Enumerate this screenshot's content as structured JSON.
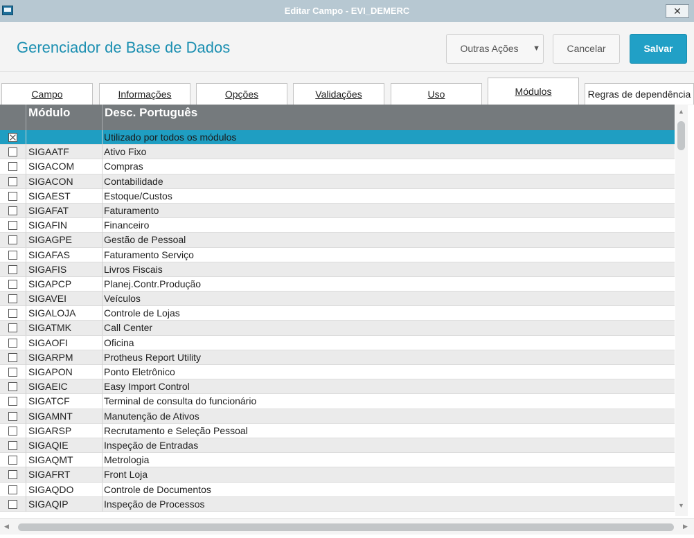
{
  "window": {
    "title": "Editar Campo - EVI_DEMERC",
    "close_glyph": "✕"
  },
  "header": {
    "title": "Gerenciador de Base de Dados",
    "other_actions_label": "Outras Ações",
    "cancel_label": "Cancelar",
    "save_label": "Salvar"
  },
  "tabs": [
    {
      "label": "Campo"
    },
    {
      "label": "Informações"
    },
    {
      "label": "Opções"
    },
    {
      "label": "Validações"
    },
    {
      "label": "Uso"
    },
    {
      "label": "Módulos",
      "active": true
    },
    {
      "label": "Regras de dependência"
    }
  ],
  "grid": {
    "columns": [
      "",
      "Módulo",
      "Desc. Português"
    ],
    "rows": [
      {
        "checked": true,
        "module": "",
        "desc": "Utilizado por todos os módulos",
        "selected": true
      },
      {
        "checked": false,
        "module": "SIGAATF",
        "desc": "Ativo Fixo"
      },
      {
        "checked": false,
        "module": "SIGACOM",
        "desc": "Compras"
      },
      {
        "checked": false,
        "module": "SIGACON",
        "desc": "Contabilidade"
      },
      {
        "checked": false,
        "module": "SIGAEST",
        "desc": "Estoque/Custos"
      },
      {
        "checked": false,
        "module": "SIGAFAT",
        "desc": "Faturamento"
      },
      {
        "checked": false,
        "module": "SIGAFIN",
        "desc": "Financeiro"
      },
      {
        "checked": false,
        "module": "SIGAGPE",
        "desc": "Gestão de Pessoal"
      },
      {
        "checked": false,
        "module": "SIGAFAS",
        "desc": "Faturamento Serviço"
      },
      {
        "checked": false,
        "module": "SIGAFIS",
        "desc": "Livros Fiscais"
      },
      {
        "checked": false,
        "module": "SIGAPCP",
        "desc": "Planej.Contr.Produção"
      },
      {
        "checked": false,
        "module": "SIGAVEI",
        "desc": "Veículos"
      },
      {
        "checked": false,
        "module": "SIGALOJA",
        "desc": "Controle de Lojas"
      },
      {
        "checked": false,
        "module": "SIGATMK",
        "desc": "Call Center"
      },
      {
        "checked": false,
        "module": "SIGAOFI",
        "desc": "Oficina"
      },
      {
        "checked": false,
        "module": "SIGARPM",
        "desc": "Protheus Report Utility"
      },
      {
        "checked": false,
        "module": "SIGAPON",
        "desc": "Ponto Eletrônico"
      },
      {
        "checked": false,
        "module": "SIGAEIC",
        "desc": "Easy Import Control"
      },
      {
        "checked": false,
        "module": "SIGATCF",
        "desc": "Terminal de consulta do funcionário"
      },
      {
        "checked": false,
        "module": "SIGAMNT",
        "desc": "Manutenção de Ativos"
      },
      {
        "checked": false,
        "module": "SIGARSP",
        "desc": "Recrutamento e Seleção Pessoal"
      },
      {
        "checked": false,
        "module": "SIGAQIE",
        "desc": "Inspeção de Entradas"
      },
      {
        "checked": false,
        "module": "SIGAQMT",
        "desc": "Metrologia"
      },
      {
        "checked": false,
        "module": "SIGAFRT",
        "desc": "Front Loja"
      },
      {
        "checked": false,
        "module": "SIGAQDO",
        "desc": "Controle de Documentos"
      },
      {
        "checked": false,
        "module": "SIGAQIP",
        "desc": "Inspeção de Processos"
      }
    ]
  },
  "colors": {
    "accent": "#1b8fb1",
    "save": "#21a0c6",
    "header_bg": "#757a7d",
    "selected_row": "#1f9ec2"
  },
  "icons": {
    "app": "app-window-icon",
    "close": "close-icon",
    "dropdown": "caret-down-icon"
  }
}
